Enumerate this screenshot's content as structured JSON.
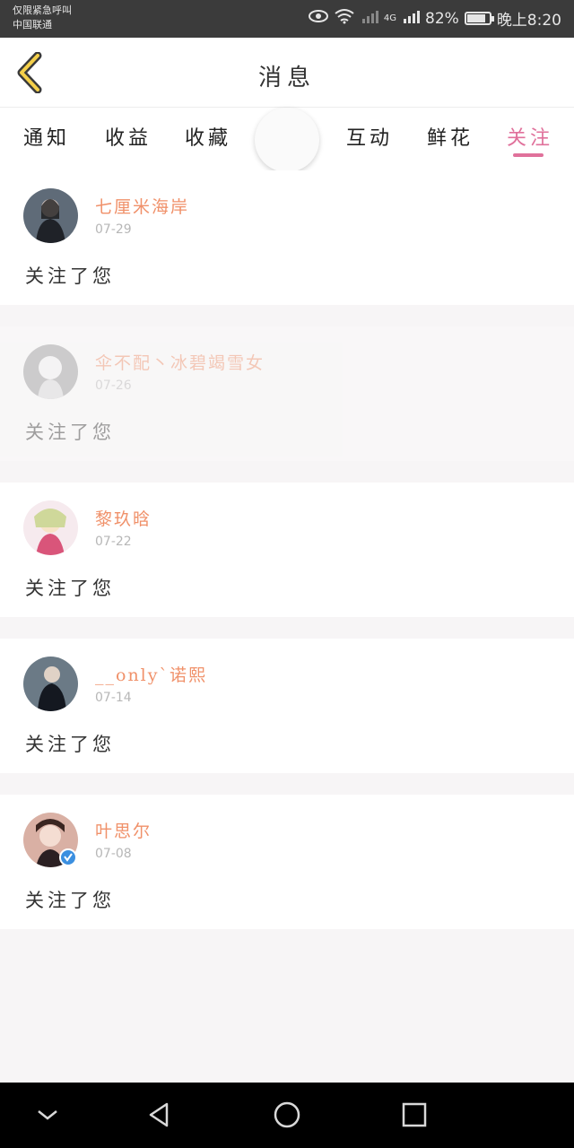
{
  "status_bar": {
    "line1": "仅限紧急呼叫",
    "line2": "中国联通",
    "network": "4G",
    "battery_percent": "82%",
    "battery_level": 0.82,
    "time": "晚上8:20"
  },
  "header": {
    "title": "消息"
  },
  "tabs": [
    {
      "label": "通知"
    },
    {
      "label": "收益"
    },
    {
      "label": "收藏"
    },
    {
      "label": "互动"
    },
    {
      "label": "鲜花"
    },
    {
      "label": "关注"
    }
  ],
  "active_tab": "关注",
  "notifications": [
    {
      "name": "七厘米海岸",
      "date": "07-29",
      "action": "关注了您",
      "avatar_color": "#3a3f4a"
    },
    {
      "name": "伞不配丶冰碧竭雪女",
      "date": "07-26",
      "action": "关注了您",
      "avatar_color": "#8c8c8c"
    },
    {
      "name": "黎玖晗",
      "date": "07-22",
      "action": "关注了您",
      "avatar_color": "#e9a9b8"
    },
    {
      "name": "__only`诺熙",
      "date": "07-14",
      "action": "关注了您",
      "avatar_color": "#2e3440"
    },
    {
      "name": "叶思尔",
      "date": "07-08",
      "action": "关注了您",
      "avatar_color": "#c79a8e"
    }
  ],
  "colors": {
    "accent": "#e0719b",
    "name": "#f0916a"
  }
}
